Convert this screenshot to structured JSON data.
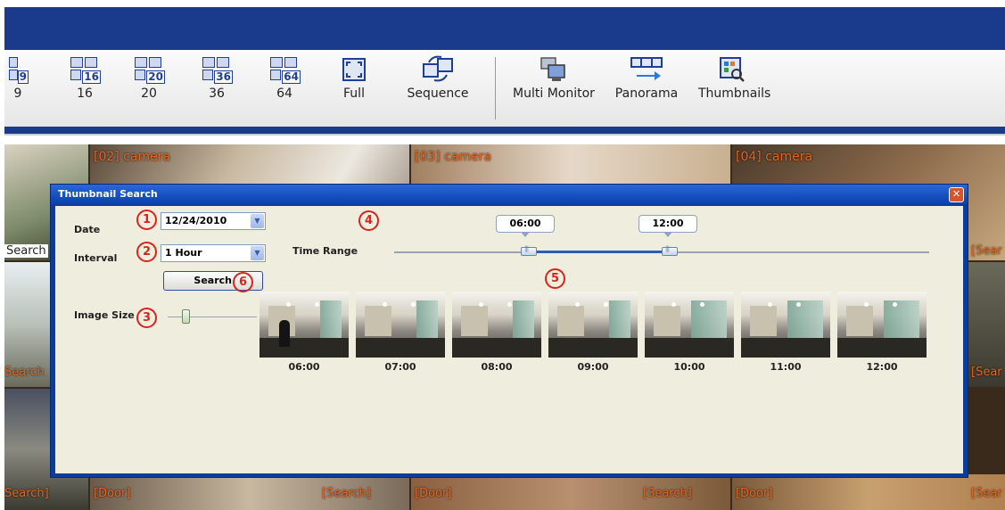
{
  "toolbar": {
    "items": [
      {
        "label": "9",
        "icon": "grid-9-icon",
        "num": "9"
      },
      {
        "label": "16",
        "icon": "grid-16-icon",
        "num": "16"
      },
      {
        "label": "20",
        "icon": "grid-20-icon",
        "num": "20"
      },
      {
        "label": "36",
        "icon": "grid-36-icon",
        "num": "36"
      },
      {
        "label": "64",
        "icon": "grid-64-icon",
        "num": "64"
      },
      {
        "label": "Full",
        "icon": "fullscreen-icon"
      },
      {
        "label": "Sequence",
        "icon": "sequence-icon"
      },
      {
        "label": "Multi Monitor",
        "icon": "multi-monitor-icon"
      },
      {
        "label": "Panorama",
        "icon": "panorama-icon"
      },
      {
        "label": "Thumbnails",
        "icon": "thumbnails-icon"
      }
    ]
  },
  "cameras": {
    "cam2": "[02] camera",
    "cam3": "[03] camera",
    "cam4": "[04] camera",
    "search": "Search",
    "search_bracket": "[Search]",
    "search_tail": "Search]",
    "door": "[Door]",
    "sear": "[Sear",
    "sear2": "[Sear"
  },
  "dialog": {
    "title": "Thumbnail Search",
    "close": "✕",
    "date_label": "Date",
    "date_value": "12/24/2010",
    "interval_label": "Interval",
    "interval_value": "1 Hour",
    "time_range_label": "Time Range",
    "range_start": "06:00",
    "range_end": "12:00",
    "search_button": "Search",
    "image_size_label": "Image Size",
    "markers": [
      "1",
      "2",
      "3",
      "4",
      "5",
      "6"
    ],
    "thumbnails": [
      "06:00",
      "07:00",
      "08:00",
      "09:00",
      "10:00",
      "11:00",
      "12:00"
    ]
  },
  "colors": {
    "title_bar": "#1a3a8c",
    "dialog_frame": "#0b3d9c",
    "marker_red": "#d6261c",
    "camera_text": "#e8641e"
  }
}
